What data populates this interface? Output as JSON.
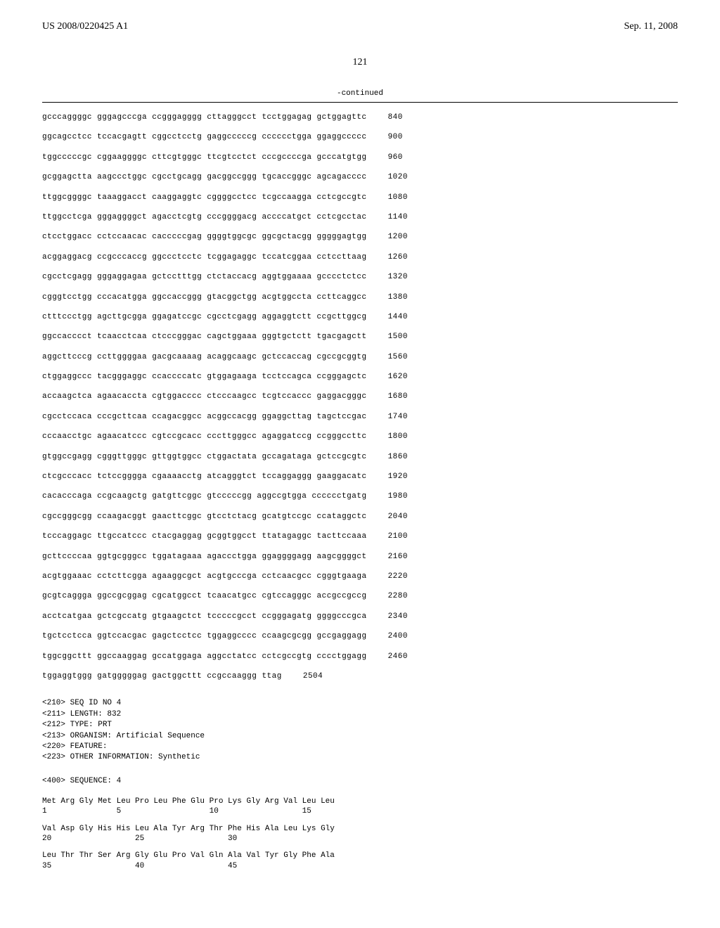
{
  "header": {
    "left": "US 2008/0220425 A1",
    "right": "Sep. 11, 2008"
  },
  "page_number": "121",
  "continued_label": "-continued",
  "sequence_rows": [
    {
      "groups": [
        "gcccaggggc",
        "gggagcccga",
        "ccgggagggg",
        "cttagggcct",
        "tcctggagag",
        "gctggagttc"
      ],
      "pos": "840"
    },
    {
      "groups": [
        "ggcagcctcc",
        "tccacgagtt",
        "cggcctcctg",
        "gaggcccccg",
        "cccccctgga",
        "ggaggccccc"
      ],
      "pos": "900"
    },
    {
      "groups": [
        "tggcccccgc",
        "cggaaggggc",
        "cttcgtgggc",
        "ttcgtcctct",
        "cccgccccga",
        "gcccatgtgg"
      ],
      "pos": "960"
    },
    {
      "groups": [
        "gcggagctta",
        "aagccctggc",
        "cgcctgcagg",
        "gacggccggg",
        "tgcaccgggc",
        "agcagacccc"
      ],
      "pos": "1020"
    },
    {
      "groups": [
        "ttggcggggc",
        "taaaggacct",
        "caaggaggtc",
        "cggggcctcc",
        "tcgccaagga",
        "cctcgccgtc"
      ],
      "pos": "1080"
    },
    {
      "groups": [
        "ttggcctcga",
        "gggaggggct",
        "agacctcgtg",
        "cccggggacg",
        "accccatgct",
        "cctcgcctac"
      ],
      "pos": "1140"
    },
    {
      "groups": [
        "ctcctggacc",
        "cctccaacac",
        "cacccccgag",
        "ggggtggcgc",
        "ggcgctacgg",
        "gggggagtgg"
      ],
      "pos": "1200"
    },
    {
      "groups": [
        "acggaggacg",
        "ccgcccaccg",
        "ggccctcctc",
        "tcggagaggc",
        "tccatcggaa",
        "cctccttaag"
      ],
      "pos": "1260"
    },
    {
      "groups": [
        "cgcctcgagg",
        "gggaggagaa",
        "gctcctttgg",
        "ctctaccacg",
        "aggtggaaaa",
        "gcccctctcc"
      ],
      "pos": "1320"
    },
    {
      "groups": [
        "cgggtcctgg",
        "cccacatgga",
        "ggccaccggg",
        "gtacggctgg",
        "acgtggccta",
        "ccttcaggcc"
      ],
      "pos": "1380"
    },
    {
      "groups": [
        "ctttccctgg",
        "agcttgcgga",
        "ggagatccgc",
        "cgcctcgagg",
        "aggaggtctt",
        "ccgcttggcg"
      ],
      "pos": "1440"
    },
    {
      "groups": [
        "ggccacccct",
        "tcaacctcaa",
        "ctcccgggac",
        "cagctggaaa",
        "gggtgctctt",
        "tgacgagctt"
      ],
      "pos": "1500"
    },
    {
      "groups": [
        "aggcttcccg",
        "ccttggggaa",
        "gacgcaaaag",
        "acaggcaagc",
        "gctccaccag",
        "cgccgcggtg"
      ],
      "pos": "1560"
    },
    {
      "groups": [
        "ctggaggccc",
        "tacgggaggc",
        "ccaccccatc",
        "gtggagaaga",
        "tcctccagca",
        "ccgggagctc"
      ],
      "pos": "1620"
    },
    {
      "groups": [
        "accaagctca",
        "agaacaccta",
        "cgtggacccc",
        "ctcccaagcc",
        "tcgtccaccc",
        "gaggacgggc"
      ],
      "pos": "1680"
    },
    {
      "groups": [
        "cgcctccaca",
        "cccgcttcaa",
        "ccagacggcc",
        "acggccacgg",
        "ggaggcttag",
        "tagctccgac"
      ],
      "pos": "1740"
    },
    {
      "groups": [
        "cccaacctgc",
        "agaacatccc",
        "cgtccgcacc",
        "cccttgggcc",
        "agaggatccg",
        "ccgggccttc"
      ],
      "pos": "1800"
    },
    {
      "groups": [
        "gtggccgagg",
        "cgggttgggc",
        "gttggtggcc",
        "ctggactata",
        "gccagataga",
        "gctccgcgtc"
      ],
      "pos": "1860"
    },
    {
      "groups": [
        "ctcgcccacc",
        "tctccgggga",
        "cgaaaacctg",
        "atcagggtct",
        "tccaggaggg",
        "gaaggacatc"
      ],
      "pos": "1920"
    },
    {
      "groups": [
        "cacacccaga",
        "ccgcaagctg",
        "gatgttcggc",
        "gtcccccgg",
        "aggccgtgga",
        "cccccctgatg"
      ],
      "pos": "1980"
    },
    {
      "groups": [
        "cgccgggcgg",
        "ccaagacggt",
        "gaacttcggc",
        "gtcctctacg",
        "gcatgtccgc",
        "ccataggctc"
      ],
      "pos": "2040"
    },
    {
      "groups": [
        "tcccaggagc",
        "ttgccatccc",
        "ctacgaggag",
        "gcggtggcct",
        "ttatagaggc",
        "tacttccaaa"
      ],
      "pos": "2100"
    },
    {
      "groups": [
        "gcttccccaa",
        "ggtgcgggcc",
        "tggatagaaa",
        "agaccctgga",
        "ggaggggagg",
        "aagcggggct"
      ],
      "pos": "2160"
    },
    {
      "groups": [
        "acgtggaaac",
        "cctcttcgga",
        "agaaggcgct",
        "acgtgcccga",
        "cctcaacgcc",
        "cgggtgaaga"
      ],
      "pos": "2220"
    },
    {
      "groups": [
        "gcgtcaggga",
        "ggccgcggag",
        "cgcatggcct",
        "tcaacatgcc",
        "cgtccagggc",
        "accgccgccg"
      ],
      "pos": "2280"
    },
    {
      "groups": [
        "acctcatgaa",
        "gctcgccatg",
        "gtgaagctct",
        "tcccccgcct",
        "ccgggagatg",
        "ggggcccgca"
      ],
      "pos": "2340"
    },
    {
      "groups": [
        "tgctcctcca",
        "ggtccacgac",
        "gagctcctcc",
        "tggaggcccc",
        "ccaagcgcgg",
        "gccgaggagg"
      ],
      "pos": "2400"
    },
    {
      "groups": [
        "tggcggcttt",
        "ggccaaggag",
        "gccatggaga",
        "aggcctatcc",
        "cctcgccgtg",
        "cccctggagg"
      ],
      "pos": "2460"
    },
    {
      "groups": [
        "tggaggtggg",
        "gatgggggag",
        "gactggcttt",
        "ccgccaaggg",
        "ttag"
      ],
      "pos": "2504"
    }
  ],
  "metadata": {
    "lines": [
      "<210> SEQ ID NO 4",
      "<211> LENGTH: 832",
      "<212> TYPE: PRT",
      "<213> ORGANISM: Artificial Sequence",
      "<220> FEATURE:",
      "<223> OTHER INFORMATION: Synthetic"
    ],
    "sequence_label": "<400> SEQUENCE: 4"
  },
  "protein_rows": [
    {
      "aa": "Met Arg Gly Met Leu Pro Leu Phe Glu Pro Lys Gly Arg Val Leu Leu",
      "nums": "1               5                   10                  15"
    },
    {
      "aa": "Val Asp Gly His His Leu Ala Tyr Arg Thr Phe His Ala Leu Lys Gly",
      "nums": "20                  25                  30"
    },
    {
      "aa": "Leu Thr Thr Ser Arg Gly Glu Pro Val Gln Ala Val Tyr Gly Phe Ala",
      "nums": "35                  40                  45"
    }
  ]
}
